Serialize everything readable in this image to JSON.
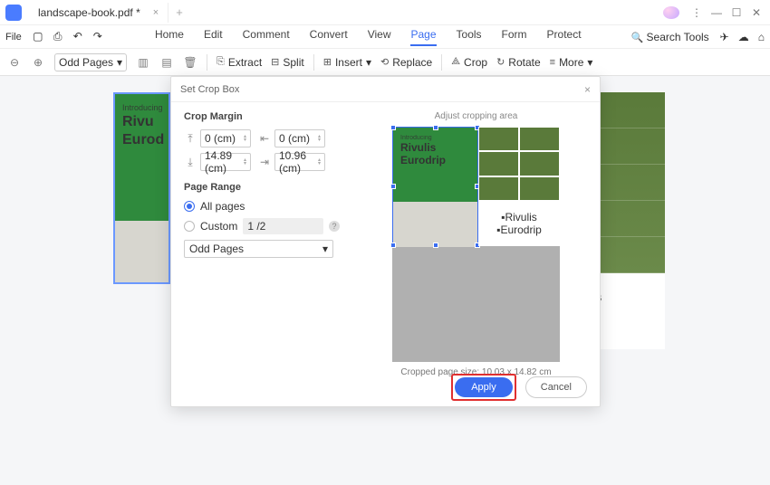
{
  "titlebar": {
    "tab": "landscape-book.pdf *",
    "close": "×",
    "plus": "+"
  },
  "menubar": {
    "file": "File",
    "items": [
      "Home",
      "Edit",
      "Comment",
      "Convert",
      "View",
      "Page",
      "Tools",
      "Form",
      "Protect"
    ],
    "active": "Page",
    "search": "Search Tools"
  },
  "toolbar": {
    "odd": "Odd Pages",
    "extract": "Extract",
    "split": "Split",
    "insert": "Insert",
    "replace": "Replace",
    "crop": "Crop",
    "rotate": "Rotate",
    "more": "More",
    "car": "▾"
  },
  "thumb": {
    "intro": "Introducing",
    "t2": "Rivu",
    "t3": "Eurod"
  },
  "bigpage": {
    "a": "ılis",
    "b": "lrip"
  },
  "dialog": {
    "title": "Set Crop Box",
    "close": "×",
    "crop_margin": "Crop Margin",
    "top": "0 (cm)",
    "left": "0 (cm)",
    "bottom": "14.89 (cm)",
    "right": "10.96 (cm)",
    "page_range": "Page Range",
    "all": "All pages",
    "custom": "Custom",
    "custom_ph": "1 /2",
    "odd": "Odd Pages",
    "adjust": "Adjust cropping area",
    "prev": {
      "intro": "Introducing",
      "r": "Rivulis",
      "e": "Eurodrip",
      "lg1": "▪Rivulis",
      "lg2": "▪Eurodrip"
    },
    "cropped": "Cropped page size: 10.03 x 14.82 cm",
    "apply": "Apply",
    "cancel": "Cancel"
  }
}
